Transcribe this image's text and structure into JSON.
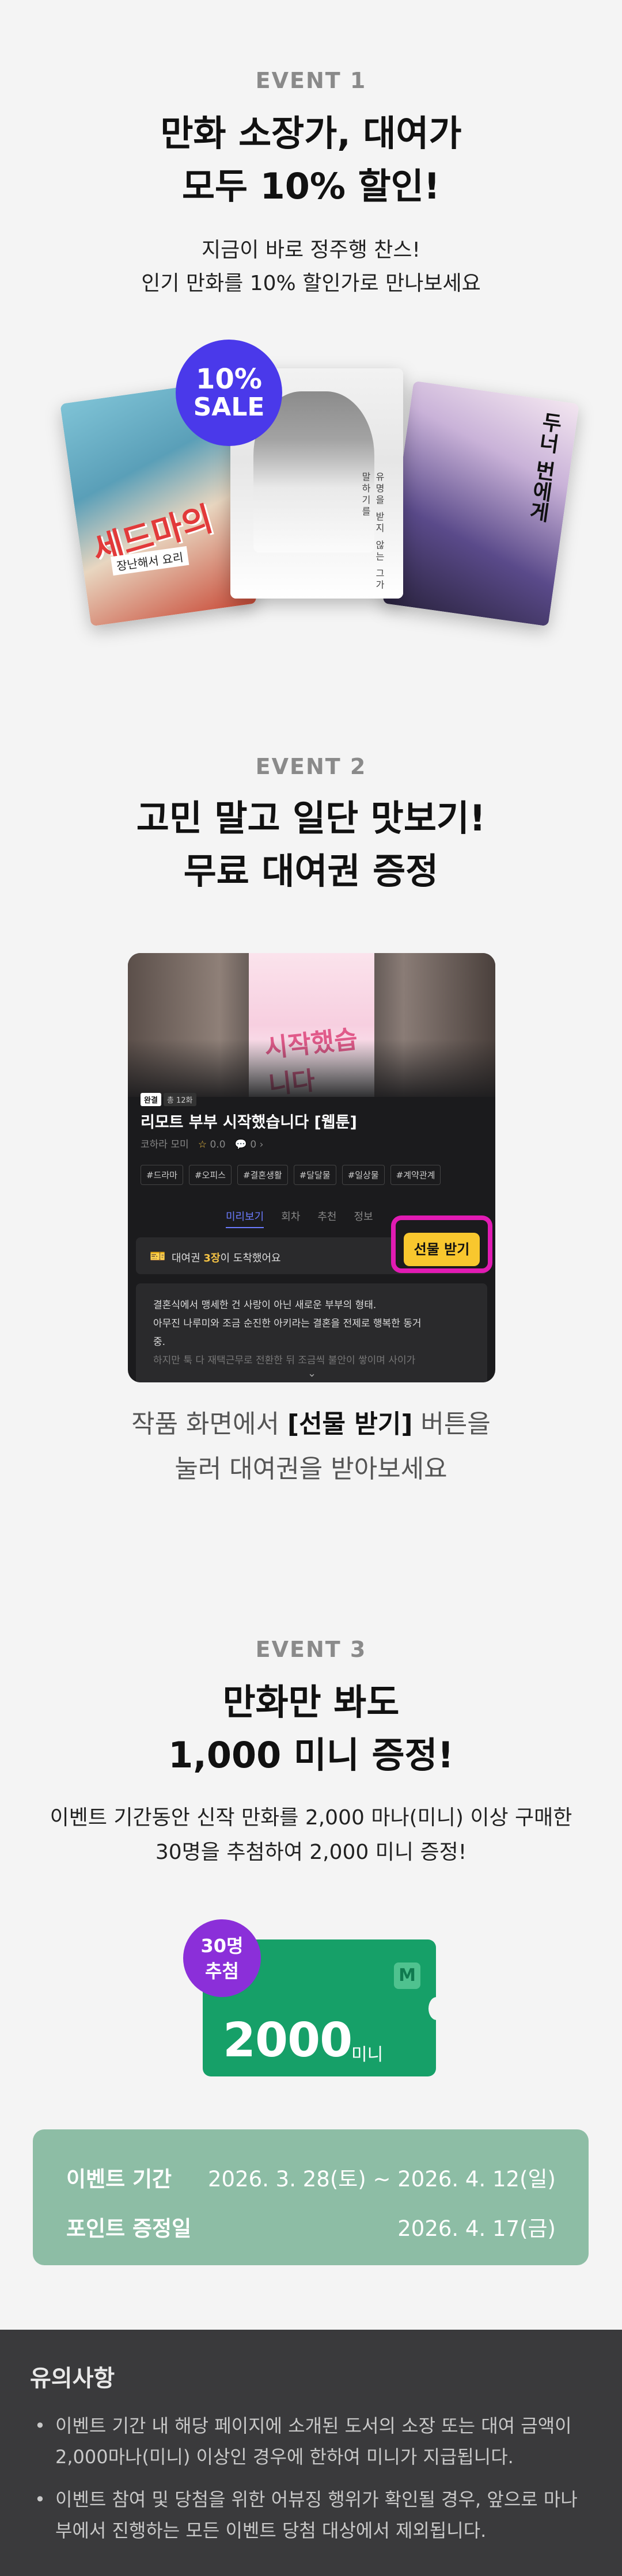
{
  "event1": {
    "label": "EVENT 1",
    "headline_1": "만화 소장가, 대여가",
    "headline_2": "모두 10% 할인!",
    "desc_1": "지금이 바로 정주행 찬스!",
    "desc_2": "인기 만화를 10% 할인가로 만나보세요",
    "badge_pct": "10%",
    "badge_word": "SALE",
    "cover_left_title": "세드마의",
    "cover_left_sub": "장난해서 요리",
    "cover_mid_text": "유명을 받지 않는 그가 말하기를",
    "cover_right_title": "두너 번에게"
  },
  "event2": {
    "label": "EVENT 2",
    "headline_1": "고민 말고 일단 맛보기!",
    "headline_2": "무료 대여권 증정",
    "phone": {
      "cover_text": "시작했습니다",
      "tag_1": "완결",
      "tag_2": "총 12화",
      "title": "리모트 부부 시작했습니다 [웹툰]",
      "meta_author": "코하라 모미",
      "meta_rating": "0.0",
      "meta_comments": "0",
      "genres": [
        "#드라마",
        "#오피스",
        "#결혼생활",
        "#달달물",
        "#일상물",
        "#계약관계"
      ],
      "tabs": [
        "미리보기",
        "회차",
        "추천",
        "정보"
      ],
      "pass_msg_pre": "대여권 ",
      "pass_msg_bold": "3장",
      "pass_msg_post": "이 도착했어요",
      "gift_button": "선물 받기",
      "synopsis_1": "결혼식에서 맹세한 건 사랑이 아닌 새로운 부부의 형태.",
      "synopsis_2": "아무진 나루미와 조금 순진한 아키라는 결혼을 전제로 행복한 동거",
      "synopsis_3": "중.",
      "synopsis_4": "하지만 툭 다 재택근무로 전환한 뒤 조금씩 불안이 쌓이며 사이가"
    },
    "desc_1_pre": "작품 화면에서 ",
    "desc_1_bold": "[선물 받기]",
    "desc_1_post": " 버튼을",
    "desc_2": "눌러 대여권을 받아보세요"
  },
  "event3": {
    "label": "EVENT 3",
    "headline_1": "만화만 봐도",
    "headline_2": "1,000 미니 증정!",
    "desc_1": "이벤트 기간동안 신작 만화를 2,000 마나(미니) 이상 구매한",
    "desc_2": "30명을 추첨하여 2,000 미니 증정!",
    "badge_line_1": "30명",
    "badge_line_2": "추첨",
    "coupon_icon": "M",
    "coupon_amount": "2000",
    "coupon_unit": "미니"
  },
  "info": {
    "period_label": "이벤트 기간",
    "period_value": "2026. 3. 28(토) ~ 2026. 4. 12(일)",
    "payout_label": "포인트 증정일",
    "payout_value": "2026. 4. 17(금)"
  },
  "notice": {
    "title": "유의사항",
    "item_1": "이벤트 기간 내 해당 페이지에 소개된 도서의 소장 또는 대여 금액이 2,000마나(미니) 이상인 경우에 한하여 미니가 지급됩니다.",
    "item_2": "이벤트 참여 및 당첨을 위한 어뷰징 행위가 확인될 경우, 앞으로 마나부에서 진행하는 모든 이벤트 당첨 대상에서 제외됩니다."
  },
  "colors": {
    "background": "#f4f4f4",
    "sale_badge": "#4a39ea",
    "gift_highlight": "#e11bb3",
    "gift_button": "#f8c72e",
    "coupon": "#16a068",
    "draw_badge": "#8b2fd9",
    "info_box": "#8dbda5",
    "notice_bg": "#3a3a3c"
  },
  "icons": [
    "ticket-icon",
    "star-icon",
    "comment-icon",
    "chevron-down-icon",
    "mini-coin-icon"
  ]
}
